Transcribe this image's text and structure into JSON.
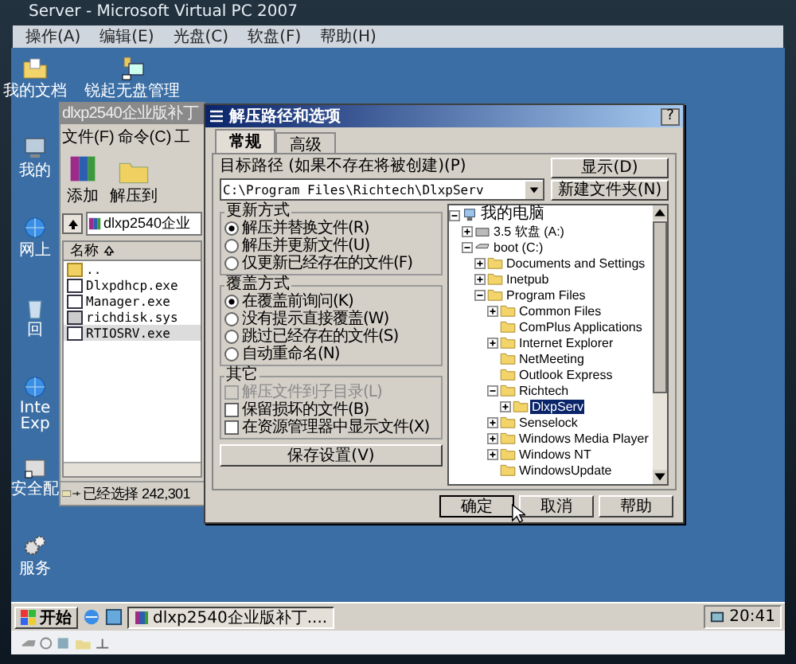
{
  "vpc": {
    "title": "Server - Microsoft Virtual PC 2007",
    "menu": [
      "操作(A)",
      "编辑(E)",
      "光盘(C)",
      "软盘(F)",
      "帮助(H)"
    ]
  },
  "desktop_icons": [
    {
      "label": "我的文档",
      "kind": "documents"
    },
    {
      "label": "我的",
      "kind": "computer"
    },
    {
      "label": "网上",
      "kind": "network"
    },
    {
      "label": "回",
      "kind": "recycle"
    },
    {
      "label": "Inte Exp",
      "kind": "browser"
    },
    {
      "label": "安全配",
      "kind": "shortcut"
    },
    {
      "label": "服务",
      "kind": "gears"
    }
  ],
  "desktop_app": {
    "label": "锐起无盘管理",
    "kind": "app"
  },
  "winrar": {
    "title": "dlxp2540企业版补丁",
    "menu": [
      "文件(F)",
      "命令(C)",
      "工"
    ],
    "toolbar": [
      {
        "label": "添加",
        "kind": "add"
      },
      {
        "label": "解压到",
        "kind": "extract"
      }
    ],
    "address": "dlxp2540企业",
    "column": "名称",
    "files": [
      {
        "name": "..",
        "kind": "folder",
        "selected": false
      },
      {
        "name": "Dlxpdhcp.exe",
        "kind": "exe",
        "selected": false
      },
      {
        "name": "Manager.exe",
        "kind": "exe",
        "selected": false
      },
      {
        "name": "richdisk.sys",
        "kind": "sys",
        "selected": false
      },
      {
        "name": "RTIOSRV.exe",
        "kind": "exe",
        "selected": true
      }
    ],
    "status": "已经选择 242,301"
  },
  "dialog": {
    "title": "解压路径和选项",
    "help": "?",
    "tabs": [
      {
        "label": "常规",
        "selected": true
      },
      {
        "label": "高级",
        "selected": false
      }
    ],
    "path_label": "目标路径 (如果不存在将被创建)(P)",
    "path_value": "C:\\Program Files\\Richtech\\DlxpServ",
    "side_buttons": [
      "显示(D)",
      "新建文件夹(N)"
    ],
    "groups": [
      {
        "title": "更新方式",
        "items": [
          {
            "kind": "radio",
            "label": "解压并替换文件(R)",
            "checked": true,
            "disabled": false
          },
          {
            "kind": "radio",
            "label": "解压并更新文件(U)",
            "checked": false,
            "disabled": false
          },
          {
            "kind": "radio",
            "label": "仅更新已经存在的文件(F)",
            "checked": false,
            "disabled": false
          }
        ]
      },
      {
        "title": "覆盖方式",
        "items": [
          {
            "kind": "radio",
            "label": "在覆盖前询问(K)",
            "checked": true,
            "disabled": false
          },
          {
            "kind": "radio",
            "label": "没有提示直接覆盖(W)",
            "checked": false,
            "disabled": false
          },
          {
            "kind": "radio",
            "label": "跳过已经存在的文件(S)",
            "checked": false,
            "disabled": false
          },
          {
            "kind": "radio",
            "label": "自动重命名(N)",
            "checked": false,
            "disabled": false
          }
        ]
      },
      {
        "title": "其它",
        "items": [
          {
            "kind": "checkbox",
            "label": "解压文件到子目录(L)",
            "checked": false,
            "disabled": true
          },
          {
            "kind": "checkbox",
            "label": "保留损坏的文件(B)",
            "checked": false,
            "disabled": false
          },
          {
            "kind": "checkbox",
            "label": "在资源管理器中显示文件(X)",
            "checked": false,
            "disabled": false
          }
        ]
      }
    ],
    "save_button": "保存设置(V)",
    "tree": [
      {
        "label": "我的电脑",
        "kind": "computer",
        "expanded": true,
        "selected": false,
        "children": [
          {
            "label": "3.5 软盘 (A:)",
            "kind": "floppy",
            "expanded": false,
            "selected": false
          },
          {
            "label": "boot (C:)",
            "kind": "drive",
            "expanded": true,
            "selected": false,
            "children": [
              {
                "label": "Documents and Settings",
                "kind": "folder",
                "expanded": false,
                "selected": false
              },
              {
                "label": "Inetpub",
                "kind": "folder",
                "expanded": false,
                "selected": false
              },
              {
                "label": "Program Files",
                "kind": "folder",
                "expanded": true,
                "selected": false,
                "children": [
                  {
                    "label": "Common Files",
                    "kind": "folder",
                    "expanded": false,
                    "selected": false
                  },
                  {
                    "label": "ComPlus Applications",
                    "kind": "folder",
                    "selected": false
                  },
                  {
                    "label": "Internet Explorer",
                    "kind": "folder",
                    "expanded": false,
                    "selected": false
                  },
                  {
                    "label": "NetMeeting",
                    "kind": "folder",
                    "selected": false
                  },
                  {
                    "label": "Outlook Express",
                    "kind": "folder",
                    "selected": false
                  },
                  {
                    "label": "Richtech",
                    "kind": "folder",
                    "expanded": true,
                    "selected": false,
                    "children": [
                      {
                        "label": "DlxpServ",
                        "kind": "folder",
                        "expanded": false,
                        "selected": true
                      }
                    ]
                  },
                  {
                    "label": "Senselock",
                    "kind": "folder",
                    "expanded": false,
                    "selected": false
                  },
                  {
                    "label": "Windows Media Player",
                    "kind": "folder",
                    "expanded": false,
                    "selected": false
                  },
                  {
                    "label": "Windows NT",
                    "kind": "folder",
                    "expanded": false,
                    "selected": false
                  },
                  {
                    "label": "WindowsUpdate",
                    "kind": "folder",
                    "selected": false
                  }
                ]
              }
            ]
          }
        ]
      }
    ],
    "buttons": [
      "确定",
      "取消",
      "帮助"
    ]
  },
  "taskbar": {
    "start": "开始",
    "task": "dlxp2540企业版补丁....",
    "clock": "20:41"
  }
}
